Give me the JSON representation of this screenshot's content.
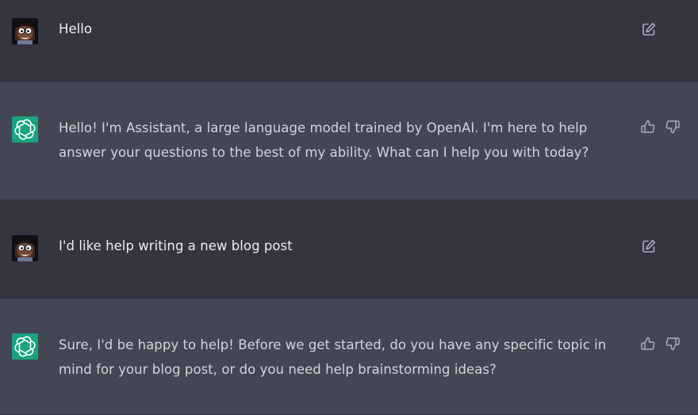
{
  "messages": [
    {
      "role": "user",
      "avatar_icon": "user-avatar-icon",
      "text": "Hello",
      "actions": [
        "edit-icon"
      ]
    },
    {
      "role": "assistant",
      "avatar_icon": "openai-logo-icon",
      "text": "Hello! I'm Assistant, a large language model trained by OpenAI. I'm here to help answer your questions to the best of my ability. What can I help you with today?",
      "actions": [
        "thumbs-up-icon",
        "thumbs-down-icon"
      ]
    },
    {
      "role": "user",
      "avatar_icon": "user-avatar-icon",
      "text": "I'd like help writing a new blog post",
      "actions": [
        "edit-icon"
      ]
    },
    {
      "role": "assistant",
      "avatar_icon": "openai-logo-icon",
      "text": "Sure, I'd be happy to help! Before we get started, do you have any specific topic in mind for your blog post, or do you need help brainstorming ideas?",
      "actions": [
        "thumbs-up-icon",
        "thumbs-down-icon"
      ]
    }
  ],
  "colors": {
    "user_row_bg": "#343541",
    "assistant_row_bg": "#444654",
    "openai_logo_bg": "#19a37f",
    "icon_color": "#acacbe"
  }
}
